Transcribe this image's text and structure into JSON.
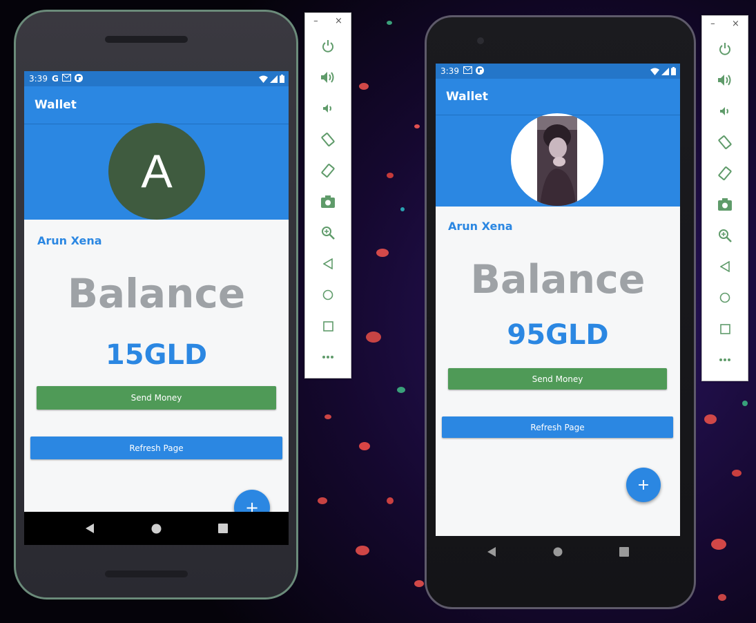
{
  "colors": {
    "primary": "#2b87e2",
    "send_button": "#4f9a57",
    "balance_label": "#9ea2a6",
    "avatar_bg": "#3f5b3f",
    "toolbar_icon": "#5f9b6a"
  },
  "phone_left": {
    "status": {
      "time": "3:39",
      "icons": [
        "google-icon",
        "gmail-icon",
        "flipboard-icon",
        "wifi-icon",
        "signal-icon",
        "battery-icon"
      ]
    },
    "appbar_title": "Wallet",
    "avatar_letter": "A",
    "user_name": "Arun Xena",
    "balance_label": "Balance",
    "balance_value": "15GLD",
    "send_button": "Send Money",
    "refresh_button": "Refresh Page",
    "fab_label": "+"
  },
  "phone_right": {
    "status": {
      "time": "3:39",
      "icons": [
        "gmail-icon",
        "flipboard-icon",
        "wifi-icon",
        "signal-icon",
        "battery-icon"
      ]
    },
    "appbar_title": "Wallet",
    "avatar": "profile-photo",
    "user_name": "Arun Xena",
    "balance_label": "Balance",
    "balance_value": "95GLD",
    "send_button": "Send Money",
    "refresh_button": "Refresh Page",
    "fab_label": "+"
  },
  "emulator_toolbar": {
    "window_controls": {
      "minimize": "–",
      "close": "×"
    },
    "items": [
      "power-icon",
      "volume-up-icon",
      "volume-down-icon",
      "rotate-left-icon",
      "rotate-right-icon",
      "screenshot-icon",
      "zoom-icon",
      "back-icon",
      "home-icon",
      "overview-icon",
      "more-icon"
    ]
  },
  "nav_bar": [
    "back-icon",
    "home-icon",
    "recents-icon"
  ]
}
